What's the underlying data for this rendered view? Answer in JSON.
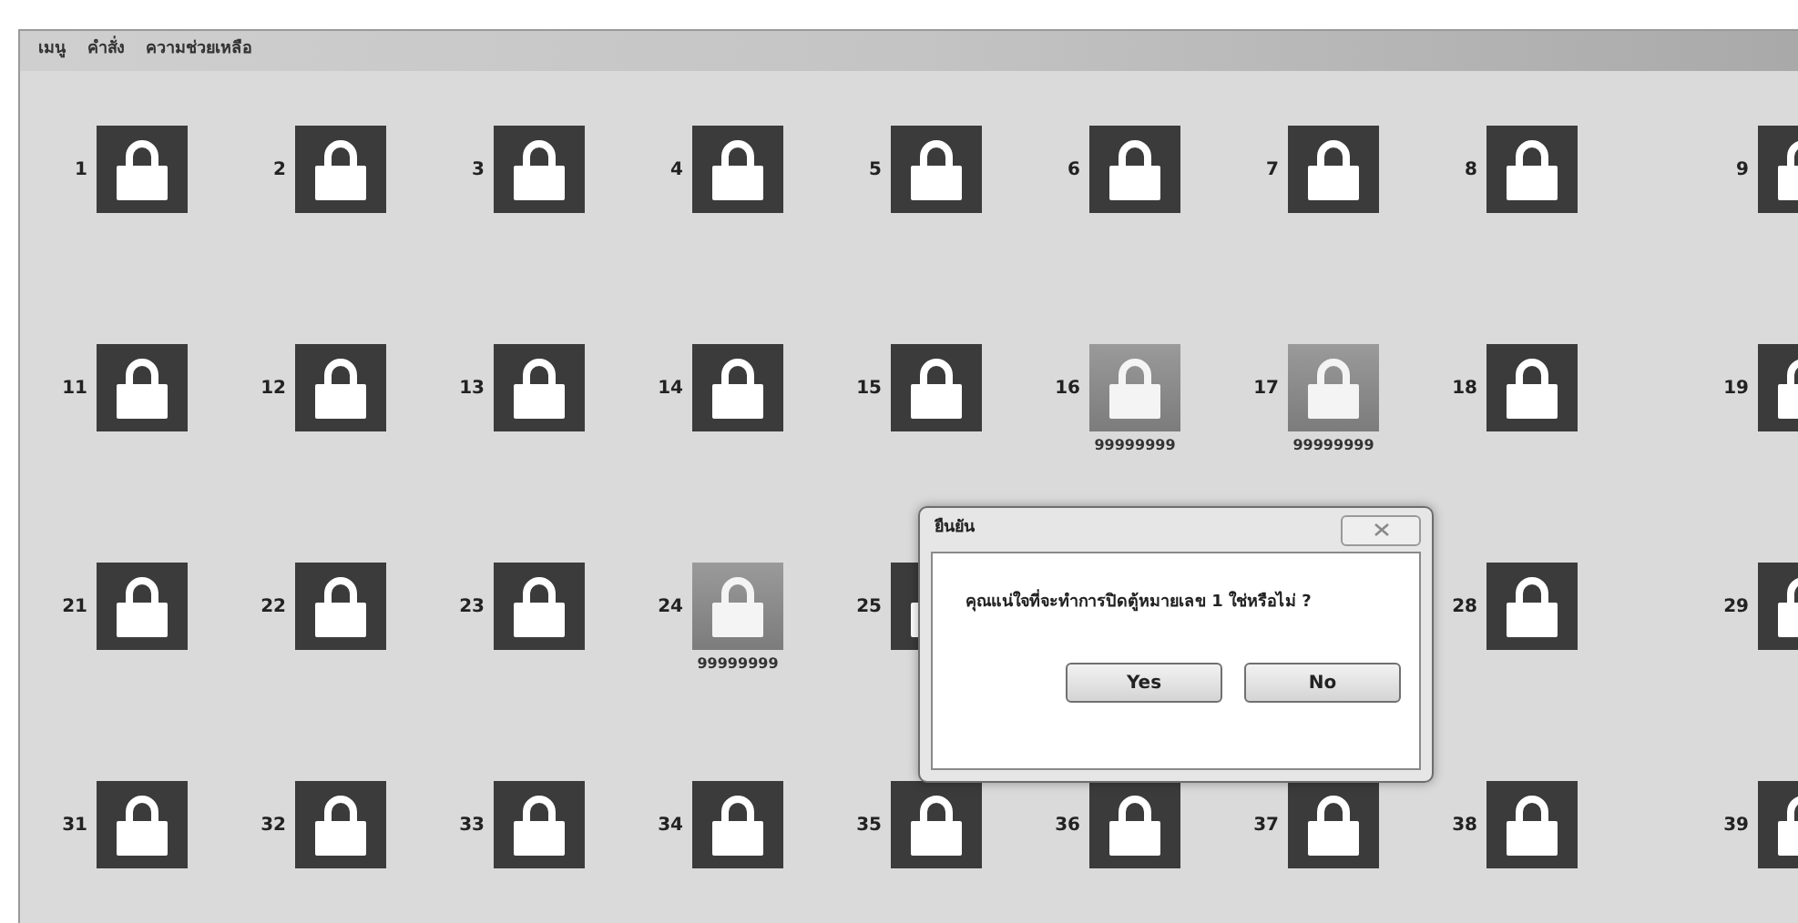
{
  "menu": [
    {
      "label": "เมนู"
    },
    {
      "label": "คำสั่ง"
    },
    {
      "label": "ความช่วยเหลือ"
    }
  ],
  "rows": [
    {
      "lockers": [
        {
          "number": "1",
          "in_use": false
        },
        {
          "number": "2",
          "in_use": false
        },
        {
          "number": "3",
          "in_use": false
        },
        {
          "number": "4",
          "in_use": false
        },
        {
          "number": "5",
          "in_use": false
        },
        {
          "number": "6",
          "in_use": false
        },
        {
          "number": "7",
          "in_use": false
        },
        {
          "number": "8",
          "in_use": false
        },
        {
          "number": "9",
          "in_use": false
        }
      ]
    },
    {
      "lockers": [
        {
          "number": "11",
          "in_use": false
        },
        {
          "number": "12",
          "in_use": false
        },
        {
          "number": "13",
          "in_use": false
        },
        {
          "number": "14",
          "in_use": false
        },
        {
          "number": "15",
          "in_use": false
        },
        {
          "number": "16",
          "in_use": true,
          "code": "99999999"
        },
        {
          "number": "17",
          "in_use": true,
          "code": "99999999"
        },
        {
          "number": "18",
          "in_use": false
        },
        {
          "number": "19",
          "in_use": false
        }
      ]
    },
    {
      "lockers": [
        {
          "number": "21",
          "in_use": false
        },
        {
          "number": "22",
          "in_use": false
        },
        {
          "number": "23",
          "in_use": false
        },
        {
          "number": "24",
          "in_use": true,
          "code": "99999999"
        },
        {
          "number": "25",
          "in_use": false
        }
      ],
      "lockers_after_dialog": [
        {
          "number": "28",
          "in_use": false
        },
        {
          "number": "29",
          "in_use": false
        }
      ]
    },
    {
      "lockers": [
        {
          "number": "31",
          "in_use": false
        },
        {
          "number": "32",
          "in_use": false
        },
        {
          "number": "33",
          "in_use": false
        },
        {
          "number": "34",
          "in_use": false
        },
        {
          "number": "35",
          "in_use": false
        },
        {
          "number": "36",
          "in_use": false
        },
        {
          "number": "37",
          "in_use": false
        },
        {
          "number": "38",
          "in_use": false
        },
        {
          "number": "39",
          "in_use": false
        }
      ]
    }
  ],
  "dialog": {
    "title": "ยืนยัน",
    "message": "คุณแน่ใจที่จะทำการปิดตู้หมายเลข 1 ใช่หรือไม่ ?",
    "buttons": [
      {
        "label": "Yes"
      },
      {
        "label": "No"
      }
    ]
  }
}
